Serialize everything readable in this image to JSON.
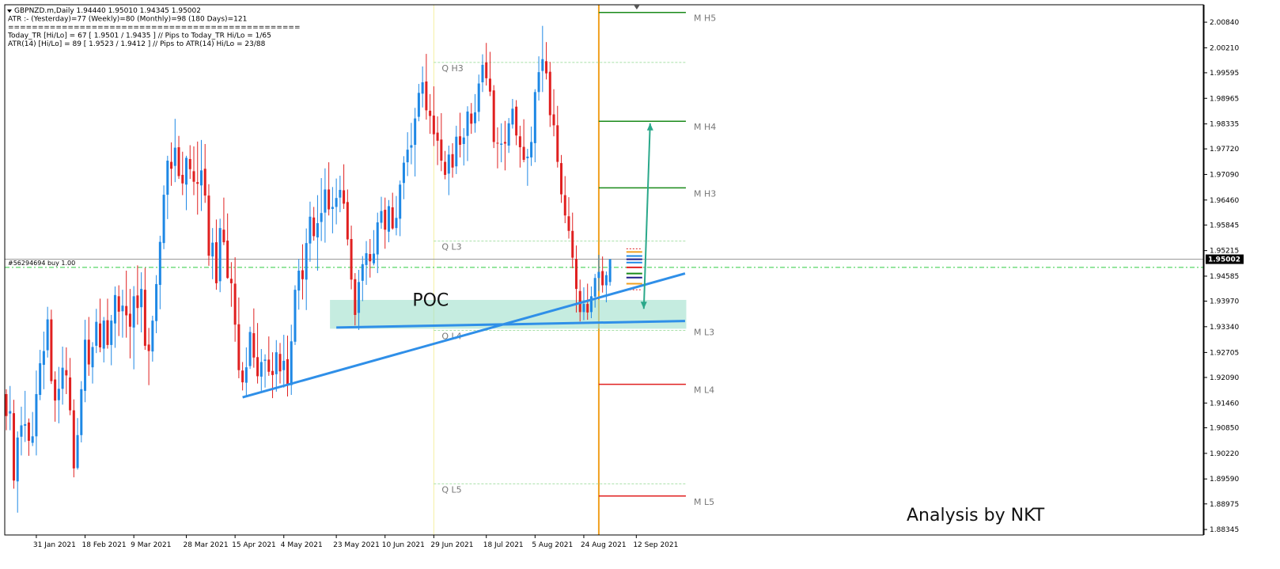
{
  "header": {
    "lines": [
      "GBPNZD.m,Daily  1.94440 1.95010 1.94345 1.95002",
      "ATR :- (Yesterday)=77       (Weekly)=80       (Monthly)=98       (180 Days)=121",
      "=================================================",
      "Today_TR [Hi/Lo] = 67 [ 1.9501 / 1.9435 ]   // Pips to Today_TR Hi/Lo  = 1/65",
      "ATR(14)       [Hi/Lo] = 89 [ 1.9523 / 1.9412 ]  //  Pips to ATR(14) Hi/Lo     = 23/88"
    ]
  },
  "order_line": {
    "label": "#56294694 buy 1.00",
    "price": 1.948,
    "color": "#2ecc40"
  },
  "current_price": {
    "label": "1.95002",
    "value": 1.95002
  },
  "annotations": {
    "poc": "POC",
    "credit": "Analysis by NKT"
  },
  "chart_data": {
    "type": "candlestick",
    "symbol": "GBPNZD.m",
    "timeframe": "Daily",
    "y_ticks": [
      2.0084,
      2.0021,
      1.99595,
      1.98965,
      1.98335,
      1.9772,
      1.9709,
      1.9646,
      1.95845,
      1.95215,
      1.94585,
      1.9397,
      1.9334,
      1.92705,
      1.9209,
      1.9146,
      1.9085,
      1.9022,
      1.8959,
      1.88975,
      1.88345
    ],
    "y_tick_labels": [
      "2.00840",
      "2.00210",
      "1.99595",
      "1.98965",
      "1.98335",
      "1.97720",
      "1.97090",
      "1.96460",
      "1.95845",
      "1.95215",
      "1.94585",
      "1.93970",
      "1.93340",
      "1.92705",
      "1.92090",
      "1.91460",
      "1.90850",
      "1.90220",
      "1.89590",
      "1.88975",
      "1.88345"
    ],
    "x_ticks": [
      "31 Jan 2021",
      "18 Feb 2021",
      "9 Mar 2021",
      "28 Mar 2021",
      "15 Apr 2021",
      "4 May 2021",
      "23 May 2021",
      "10 Jun 2021",
      "29 Jun 2021",
      "18 Jul 2021",
      "5 Aug 2021",
      "24 Aug 2021",
      "12 Sep 2021"
    ],
    "ylim": [
      1.8821,
      2.0127
    ],
    "colors": {
      "up": "#1e88e5",
      "down": "#e02020",
      "trend": "#2f8fe8",
      "poc_zone": "#9fe0cc",
      "vline_orange": "#f0a020",
      "vline_yellow": "#f5f0a0",
      "m_green": "#1a8a1a",
      "m_red": "#e02020",
      "q_dashed": "#a8e0a8",
      "arrow": "#2aa88a"
    },
    "m_levels": [
      {
        "label": "M  H5",
        "price": 2.0108,
        "color": "green"
      },
      {
        "label": "M  H4",
        "price": 1.984,
        "color": "green"
      },
      {
        "label": "M  H3",
        "price": 1.9676,
        "color": "green"
      },
      {
        "label": "M  L3",
        "price": 1.9335,
        "color": "none"
      },
      {
        "label": "M  L4",
        "price": 1.9192,
        "color": "red"
      },
      {
        "label": "M  L5",
        "price": 1.8917,
        "color": "red"
      }
    ],
    "q_levels": [
      {
        "label": "Q  H3",
        "price": 1.9985
      },
      {
        "label": "Q  L3",
        "price": 1.9545
      },
      {
        "label": "Q  L4",
        "price": 1.9325
      },
      {
        "label": "Q  L5",
        "price": 1.8947
      }
    ],
    "poc_zone": {
      "top": 1.94,
      "bottom": 1.9329
    },
    "trendlines": [
      {
        "from": [
          "19 Apr 2021",
          1.916
        ],
        "to": [
          "30 Sep 2021",
          1.9465
        ]
      },
      {
        "from": [
          "23 May 2021",
          1.9332
        ],
        "to": [
          "30 Sep 2021",
          1.9348
        ]
      }
    ],
    "target_arrow": {
      "date": "15 Sep 2021",
      "from": 1.9378,
      "to": 1.9835
    },
    "vline_dates": {
      "yellow": "29 Jun 2021",
      "orange": "29 Aug 2021"
    },
    "candles_ohlc": "1.9168,1.9180,1.9079,1.9114;1.9120,1.9188,1.9079,1.9126;1.9121,1.9154,1.8935,1.8955;1.8953,1.9076,1.8876,1.9061;1.9063,1.9137,1.9017,1.9091;1.9090,1.9176,1.9050,1.9094;1.9098,1.9108,1.9016,1.9053;1.9048,1.9124,1.9040,1.9064;1.9064,1.9226,1.9017,1.9168;1.9166,1.9277,1.9153,1.9244;1.9240,1.9322,1.9180,1.9274;1.9276,1.9383,1.9258,1.9352;1.9352,1.9376,1.9193,1.9200;1.9204,1.9224,1.9100,1.9152;1.9153,1.9235,1.9096,1.9181;1.9181,1.9285,1.9142,1.9233;1.9227,1.9283,1.9168,1.9214;1.9209,1.9257,1.9116,1.9128;1.9128,1.9155,1.8963,1.8985;1.8986,1.9109,1.8982,1.9067;1.9067,1.9200,1.9049,1.9180;1.9176,1.9351,1.9148,1.9302;1.9302,1.9358,1.9213,1.9241;1.9234,1.9296,1.9194,1.9284;1.9287,1.9378,1.9269,1.9346;1.9342,1.9403,1.9271,1.9283;1.9280,1.9358,1.9246,1.9349;1.9350,1.9403,1.9280,1.9289;1.9289,1.9363,1.9239,1.9349;1.9342,1.9433,1.9282,1.9412;1.9409,1.9436,1.9311,1.9371;1.9372,1.9425,1.9307,1.9386;1.9385,1.9472,1.9307,1.9362;1.9366,1.9427,1.9256,1.9334;1.9332,1.9434,1.9229,1.9409;1.9411,1.9485,1.9339,1.9380;1.9382,1.9468,1.9320,1.9427;1.9425,1.9479,1.9277,1.9287;1.9290,1.9331,1.9190,1.9274;1.9273,1.9361,1.9248,1.9349;1.9348,1.9461,1.9318,1.9439;1.9437,1.9558,1.9377,1.9543;1.9540,1.9682,1.9525,1.9659;1.9659,1.9755,1.9599,1.9743;1.9740,1.9788,1.9681,1.9723;1.9730,1.9846,1.9690,1.9775;1.9776,1.9804,1.9698,1.9705;1.9708,1.9765,1.9658,1.9687;1.9684,1.9755,1.9621,1.9750;1.9747,1.9781,1.9698,1.9722;1.9717,1.9778,1.9658,1.9691;1.9690,1.9790,1.9610,1.9686;1.9682,1.9794,1.9619,1.9719;1.9723,1.9784,1.9639,1.9657;1.9657,1.9685,1.9484,1.9509;1.9507,1.9577,1.9451,1.9541;1.9542,1.9598,1.9425,1.9441;1.9446,1.9600,1.9419,1.9577;1.9573,1.9652,1.9535,1.9542;1.9546,1.9613,1.9452,1.9454;1.9452,1.9493,1.9383,1.9441;1.9440,1.9505,1.9297,1.9339;1.9340,1.9406,1.9207,1.9227;1.9226,1.9247,1.9177,1.9197;1.9196,1.9283,1.9162,1.9234;1.9237,1.9334,1.9230,1.9321;1.9318,1.9379,1.9233,1.9258;1.9259,1.9343,1.9194,1.9212;1.9211,1.9279,1.9176,1.9247;1.9250,1.9266,1.9184,1.9253;1.9253,1.9310,1.9213,1.9223;1.9225,1.9271,1.9158,1.9215;1.9217,1.9301,1.9174,1.9271;1.9267,1.9294,1.9194,1.9224;1.9227,1.9314,1.9184,1.9250;1.9254,1.9312,1.9162,1.9190;1.9190,1.9339,1.9166,1.9298;1.9297,1.9436,1.9289,1.9425;1.9423,1.9501,1.9376,1.9472;1.9473,1.9537,1.9401,1.9451;1.9450,1.9576,1.9375,1.9540;1.9539,1.9642,1.9494,1.9605;1.9603,1.9629,1.9546,1.9557;1.9554,1.9658,1.9472,1.9589;1.9592,1.9700,1.9545,1.9614;1.9615,1.9724,1.9541,1.9672;1.9672,1.9739,1.9608,1.9623;1.9624,1.9678,1.9564,1.9629;1.9629,1.9699,1.9586,1.9651;1.9652,1.9706,1.9616,1.9671;1.9670,1.9734,1.9624,1.9637;1.9641,1.9672,1.9534,1.9549;1.9550,1.9583,1.9426,1.9450;1.9451,1.9466,1.9337,1.9363;1.9368,1.9474,1.9326,1.9444;1.9447,1.9508,1.9397,1.9488;1.9486,1.9545,1.9437,1.9515;1.9513,1.9550,1.9455,1.9495;1.9490,1.9572,1.9485,1.9514;1.9512,1.9615,1.9466,1.9591;1.9590,1.9654,1.9575,1.9619;1.9622,1.9652,1.9526,1.9573;1.9568,1.9646,1.9542,1.9631;1.9628,1.9664,1.9573,1.9576;1.9577,1.9656,1.9559,1.9602;1.9600,1.9694,1.9557,1.9684;1.9688,1.9754,1.9648,1.9738;1.9739,1.9813,1.9705,1.9770;1.9775,1.9836,1.9734,1.9781;1.9782,1.9873,1.9704,1.9847;1.9851,1.9932,1.9840,1.9910;1.9908,1.9975,1.9874,1.9936;1.9938,2.0006,1.9844,1.9867;1.9866,1.9907,1.9809,1.9853;1.9854,1.9926,1.9779,1.9808;1.9812,1.9852,1.9732,1.9792;1.9795,1.9860,1.9717,1.9743;1.9740,1.9767,1.9697,1.9708;1.9711,1.9780,1.9658,1.9758;1.9759,1.9786,1.9701,1.9726;1.9729,1.9829,1.9710,1.9802;1.9803,1.9861,1.9751,1.9782;1.9784,1.9823,1.9731,1.9800;1.9804,1.9877,1.9742,1.9864;1.9859,1.9885,1.9809,1.9834;1.9835,1.9907,1.9812,1.9862;1.9863,1.9955,1.9840,1.9933;1.9936,2.0005,1.9912,1.9979;1.9985,2.0033,1.9928,1.9946;1.9945,2.0011,1.9902,1.9913;1.9916,1.9929,1.9774,1.9789;1.9787,1.9825,1.9724,1.9785;1.9782,1.9835,1.9739,1.9785;1.9789,1.9841,1.9719,1.9785;1.9780,1.9848,1.9762,1.9835;1.9832,1.9895,1.9822,1.9871;1.9876,1.9892,1.9781,1.9805;1.9803,1.9829,1.9726,1.9776;1.9777,1.9845,1.9739,1.9745;1.9749,1.9772,1.9681,1.9753;1.9751,1.9827,1.9730,1.9789;1.9786,1.9919,1.9739,1.9912;1.9912,2.0000,1.9891,1.9961;1.9964,2.0075,1.9912,1.9993;1.9988,2.0035,1.9943,1.9958;1.9962,1.9986,1.9826,1.9855;1.9857,1.9919,1.9803,1.9830;1.9830,1.9878,1.9726,1.9740;1.9737,1.9757,1.9639,1.9660;1.9658,1.9705,1.9589,1.9608;1.9606,1.9653,1.9551,1.9570;1.9570,1.9615,1.9478,1.9504;1.9501,1.9534,1.9369,1.9427;1.9422,1.9450,1.9347,1.9370;1.9370,1.9431,1.9350,1.9390;1.9390,1.9440,1.9351,1.9369;1.9370,1.9433,1.9355,1.9409;1.9408,1.9464,1.9381,1.9454;1.9454,1.9511,1.9422,1.9469;1.9471,1.9507,1.9418,1.9436;1.9436,1.9470,1.9394,1.9461;1.9444,1.9501,1.9435,1.9500"
  }
}
